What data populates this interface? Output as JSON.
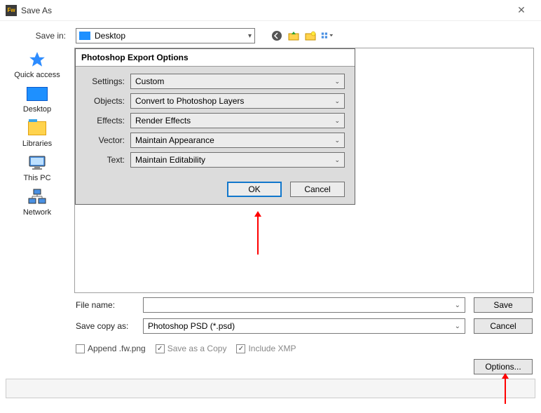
{
  "window": {
    "title": "Save As",
    "app_icon_label": "Fw"
  },
  "top": {
    "save_in_label": "Save in:",
    "save_in_value": "Desktop",
    "nav_icons": [
      "back-icon",
      "up-folder-icon",
      "new-folder-icon",
      "view-menu-icon"
    ]
  },
  "sidebar": {
    "items": [
      {
        "label": "Quick access",
        "icon": "star-icon"
      },
      {
        "label": "Desktop",
        "icon": "desktop-icon"
      },
      {
        "label": "Libraries",
        "icon": "libraries-icon"
      },
      {
        "label": "This PC",
        "icon": "pc-icon"
      },
      {
        "label": "Network",
        "icon": "network-icon"
      }
    ]
  },
  "export": {
    "title": "Photoshop Export Options",
    "rows": [
      {
        "label": "Settings:",
        "value": "Custom"
      },
      {
        "label": "Objects:",
        "value": "Convert to Photoshop Layers"
      },
      {
        "label": "Effects:",
        "value": "Render Effects"
      },
      {
        "label": "Vector:",
        "value": "Maintain Appearance"
      },
      {
        "label": "Text:",
        "value": "Maintain Editability"
      }
    ],
    "ok_label": "OK",
    "cancel_label": "Cancel"
  },
  "bottom": {
    "file_name_label": "File name:",
    "file_name_value": "",
    "save_copy_as_label": "Save copy as:",
    "save_copy_as_value": "Photoshop PSD (*.psd)",
    "save_label": "Save",
    "cancel_label": "Cancel",
    "options_label": "Options...",
    "checks": [
      {
        "label": "Append .fw.png",
        "checked": false,
        "enabled": true
      },
      {
        "label": "Save as a Copy",
        "checked": true,
        "enabled": false
      },
      {
        "label": "Include XMP",
        "checked": true,
        "enabled": false
      }
    ]
  }
}
